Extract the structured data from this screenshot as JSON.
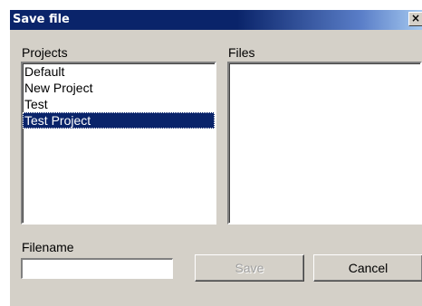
{
  "window": {
    "title": "Save file",
    "close_glyph": "×"
  },
  "projects": {
    "label": "Projects",
    "items": [
      {
        "label": "Default",
        "selected": false
      },
      {
        "label": "New Project",
        "selected": false
      },
      {
        "label": "Test",
        "selected": false
      },
      {
        "label": "Test Project",
        "selected": true
      }
    ]
  },
  "files": {
    "label": "Files",
    "items": []
  },
  "filename": {
    "label": "Filename",
    "value": "",
    "placeholder": ""
  },
  "buttons": {
    "save_label": "Save",
    "save_enabled": false,
    "cancel_label": "Cancel"
  },
  "colors": {
    "titlebar": "#0a246a",
    "selection": "#0a246a",
    "face": "#d4d0c8"
  }
}
